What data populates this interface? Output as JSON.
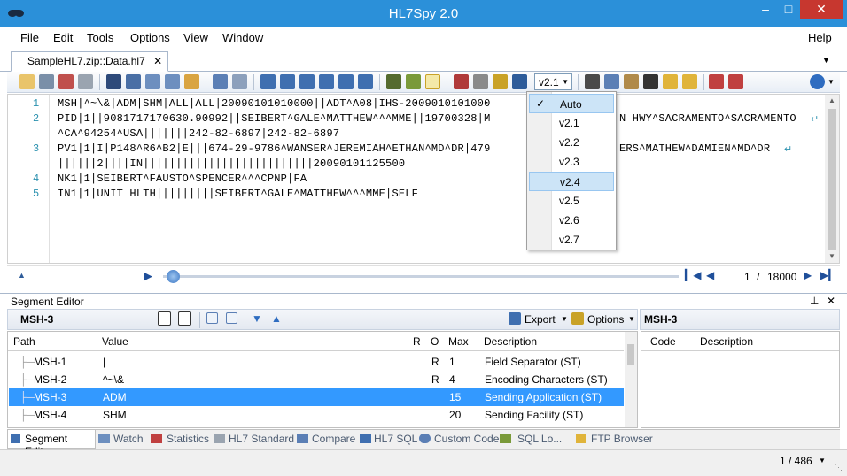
{
  "window": {
    "title": "HL7Spy 2.0"
  },
  "menu": {
    "items": [
      "File",
      "Edit",
      "Tools",
      "Options",
      "View",
      "Window"
    ],
    "help": "Help"
  },
  "doc_tab": {
    "label": "SampleHL7.zip::Data.hl7"
  },
  "toolbar": {
    "version_value": "v2.1"
  },
  "editor": {
    "lines": [
      {
        "num": "1",
        "text": "MSH|^~\\&|ADM|SHM|ALL|ALL|20090101010000||ADT^A08|IHS-2009010101000"
      },
      {
        "num": "2",
        "text": "PID|1||9081717170630.90992||SEIBERT^GALE^MATTHEW^^^MME||19700328|M"
      },
      {
        "num": "",
        "text": "^CA^94254^USA|||||||242-82-6897|242-82-6897"
      },
      {
        "num": "3",
        "text": "PV1|1|I|P148^R6^B2|E|||674-29-9786^WANSER^JEREMIAH^ETHAN^MD^DR|479"
      },
      {
        "num": "",
        "text": "||||||2||||IN||||||||||||||||||||||||||20090101125500"
      },
      {
        "num": "4",
        "text": "NK1|1|SEIBERT^FAUSTO^SPENCER^^^CPNP|FA"
      },
      {
        "num": "5",
        "text": "IN1|1|UNIT HLTH|||||||||SEIBERT^GALE^MATTHEW^^^MME|SELF"
      }
    ],
    "line2_tail": "N HWY^SACRAMENTO^SACRAMENTO",
    "line3_tail": "ERS^MATHEW^DAMIEN^MD^DR"
  },
  "nav": {
    "position": "1",
    "sep": "/",
    "total": "18000"
  },
  "version_dropdown": {
    "options": [
      "Auto",
      "v2.1",
      "v2.2",
      "v2.3",
      "v2.4",
      "v2.5",
      "v2.6",
      "v2.7"
    ],
    "checked": "Auto",
    "highlighted": "v2.4"
  },
  "segment_editor": {
    "title": "Segment Editor",
    "segment": "MSH-3",
    "export_label": "Export",
    "options_label": "Options",
    "columns": [
      "Path",
      "Value",
      "R",
      "O",
      "Max",
      "Description"
    ],
    "rows": [
      {
        "path": "MSH-1",
        "value": "|",
        "r": "",
        "o": "R",
        "max": "1",
        "desc": "Field Separator (ST)"
      },
      {
        "path": "MSH-2",
        "value": "^~\\&",
        "r": "",
        "o": "R",
        "max": "4",
        "desc": "Encoding Characters (ST)"
      },
      {
        "path": "MSH-3",
        "value": "ADM",
        "r": "",
        "o": "",
        "max": "15",
        "desc": "Sending Application (ST)"
      },
      {
        "path": "MSH-4",
        "value": "SHM",
        "r": "",
        "o": "",
        "max": "20",
        "desc": "Sending Facility (ST)"
      }
    ],
    "selected_row": 2
  },
  "right_panel": {
    "title": "MSH-3",
    "columns": [
      "Code",
      "Description"
    ]
  },
  "bottom_tabs": [
    "Segment Editor",
    "Watch",
    "Statistics",
    "HL7 Standard",
    "Compare",
    "HL7 SQL",
    "Custom Code",
    "SQL Lo...",
    "FTP Browser"
  ],
  "status": {
    "page": "1 / 486"
  },
  "colors": {
    "titlebar": "#2b90d9",
    "selection": "#3399ff",
    "highlight": "#cce4f7"
  }
}
